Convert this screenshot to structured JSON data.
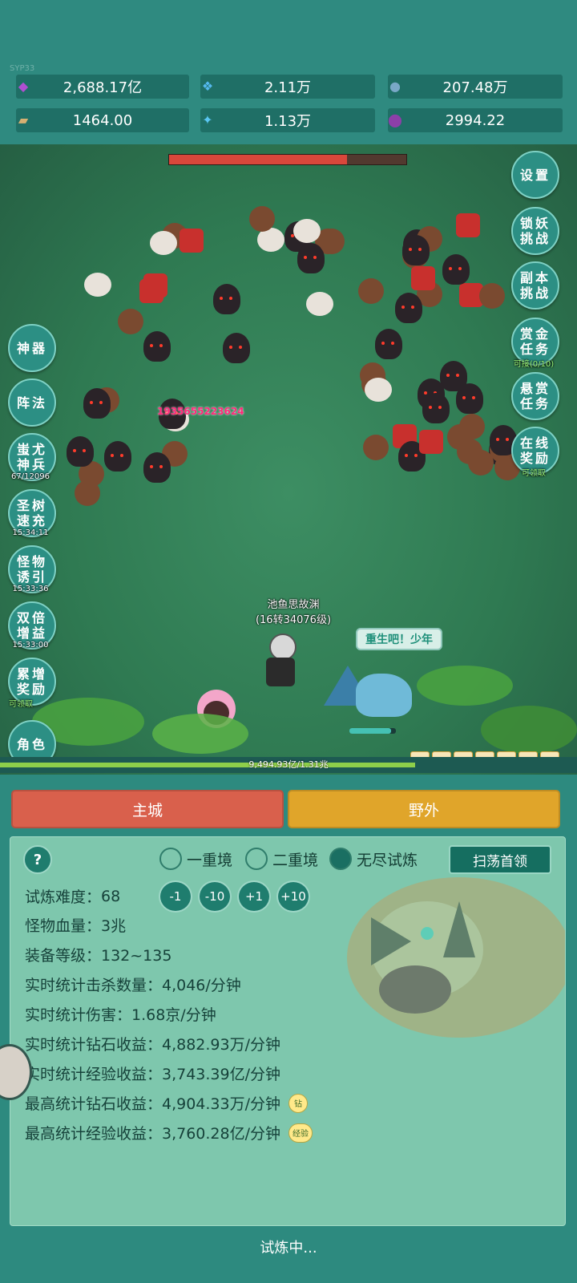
{
  "version": "SYP33",
  "resources": [
    {
      "icon": "purple-gem-icon",
      "value": "2,688.17亿",
      "color": "#b04fd1"
    },
    {
      "icon": "blue-crystal-icon",
      "value": "2.11万",
      "color": "#55b9ef"
    },
    {
      "icon": "globe-orb-icon",
      "value": "207.48万",
      "color": "#79a8c7"
    },
    {
      "icon": "scroll-icon",
      "value": "1464.00",
      "color": "#d6b072"
    },
    {
      "icon": "ice-shard-icon",
      "value": "1.13万",
      "color": "#5ac6f2"
    },
    {
      "icon": "purple-pot-icon",
      "value": "2994.22",
      "color": "#8c3fa8"
    }
  ],
  "boss_hp_fraction": 0.75,
  "right_buttons": [
    {
      "label": "设置",
      "sub": ""
    },
    {
      "label": "锁妖挑战",
      "sub": ""
    },
    {
      "label": "副本挑战",
      "sub": ""
    },
    {
      "label": "赏金任务",
      "sub": "可接(0/10)"
    },
    {
      "label": "悬赏任务",
      "sub": ""
    },
    {
      "label": "在线奖励",
      "sub": "可领取"
    }
  ],
  "left_buttons": [
    {
      "label": "神器",
      "sub": ""
    },
    {
      "label": "阵法",
      "sub": ""
    },
    {
      "label": "蚩尤神兵",
      "sub": "67/12096"
    },
    {
      "label": "圣树速充",
      "sub": "15:34:11"
    },
    {
      "label": "怪物诱引",
      "sub": "15:33:36"
    },
    {
      "label": "双倍增益",
      "sub": "15:33:00"
    },
    {
      "label": "累增奖励",
      "sub": "可领取"
    },
    {
      "label": "角色",
      "sub": ""
    }
  ],
  "damage_number": "1935655223624",
  "player": {
    "name": "池鱼思故渊",
    "level": "(16转34076级)"
  },
  "speech": "重生吧！少年",
  "exp": {
    "text": "9,494.93亿/1.31兆",
    "fraction": 0.72
  },
  "tabs": {
    "city": "主城",
    "wild": "野外",
    "city_color": "#d9604c",
    "wild_color": "#e0a52a"
  },
  "trial": {
    "help": "?",
    "modes": [
      {
        "label": "一重境",
        "selected": false
      },
      {
        "label": "二重境",
        "selected": false
      },
      {
        "label": "无尽试炼",
        "selected": true
      }
    ],
    "sweep": "扫荡首领",
    "difficulty_label": "试炼难度：",
    "difficulty": "68",
    "adjust": [
      "-1",
      "-10",
      "+1",
      "+10"
    ],
    "stats": [
      "怪物血量：3兆",
      "装备等级：132~135",
      "实时统计击杀数量：4,046/分钟",
      "实时统计伤害：1.68京/分钟",
      "实时统计钻石收益：4,882.93万/分钟",
      "实时统计经验收益：3,743.39亿/分钟",
      "最高统计钻石收益：4,904.33万/分钟",
      "最高统计经验收益：3,760.28亿/分钟"
    ],
    "tag_diamond": "钻",
    "tag_exp": "经验",
    "status": "试炼中..."
  }
}
